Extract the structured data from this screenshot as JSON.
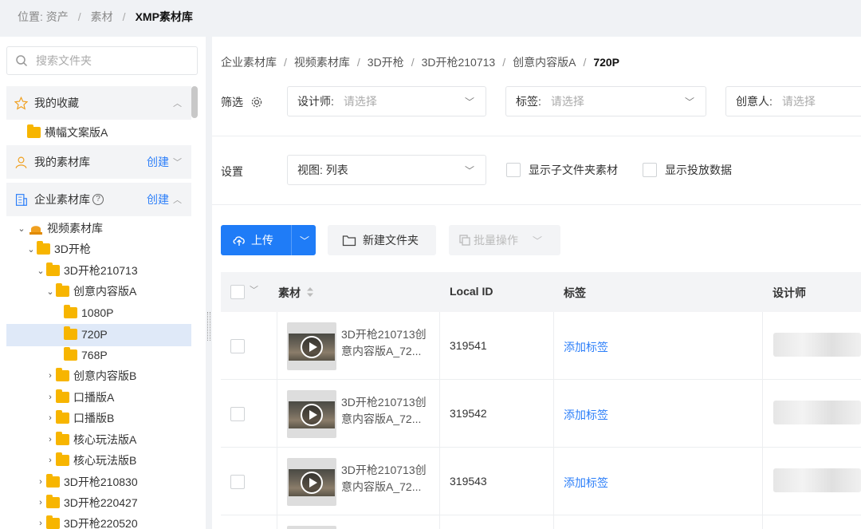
{
  "topbar": {
    "prefix": "位置: 资产",
    "items": [
      "素材",
      "XMP素材库"
    ]
  },
  "sidebar": {
    "search_placeholder": "搜索文件夹",
    "favorites": {
      "label": "我的收藏",
      "item": "横幅文案版A"
    },
    "my_library": {
      "label": "我的素材库",
      "create": "创建"
    },
    "enterprise": {
      "label": "企业素材库",
      "create": "创建"
    },
    "tree": [
      "视频素材库",
      "3D开枪",
      "3D开枪210713",
      "创意内容版A",
      "1080P",
      "720P",
      "768P",
      "创意内容版B",
      "口播版A",
      "口播版B",
      "核心玩法版A",
      "核心玩法版B",
      "3D开枪210830",
      "3D开枪220427",
      "3D开枪220520"
    ]
  },
  "breadcrumb": [
    "企业素材库",
    "视频素材库",
    "3D开枪",
    "3D开枪210713",
    "创意内容版A",
    "720P"
  ],
  "filters": {
    "label": "筛选",
    "designer": {
      "key": "设计师:",
      "placeholder": "请选择"
    },
    "tag": {
      "key": "标签:",
      "placeholder": "请选择"
    },
    "creator": {
      "key": "创意人:",
      "placeholder": "请选择"
    }
  },
  "settings": {
    "label": "设置",
    "view": "视图: 列表",
    "show_subfolder": "显示子文件夹素材",
    "show_delivery": "显示投放数据"
  },
  "toolbar": {
    "upload": "上传",
    "new_folder": "新建文件夹",
    "batch": "批量操作"
  },
  "table": {
    "headers": {
      "material": "素材",
      "local_id": "Local ID",
      "tags": "标签",
      "designer": "设计师"
    },
    "rows": [
      {
        "name_line1": "3D开枪210713创",
        "name_line2": "意内容版A_72...",
        "local_id": "319541",
        "tag": "添加标签"
      },
      {
        "name_line1": "3D开枪210713创",
        "name_line2": "意内容版A_72...",
        "local_id": "319542",
        "tag": "添加标签"
      },
      {
        "name_line1": "3D开枪210713创",
        "name_line2": "意内容版A_72...",
        "local_id": "319543",
        "tag": "添加标签"
      }
    ]
  },
  "colors": {
    "accent": "#1f7cf7",
    "link": "#2d7ff9",
    "folder": "#f7b500",
    "selected": "#dfe9f8"
  }
}
